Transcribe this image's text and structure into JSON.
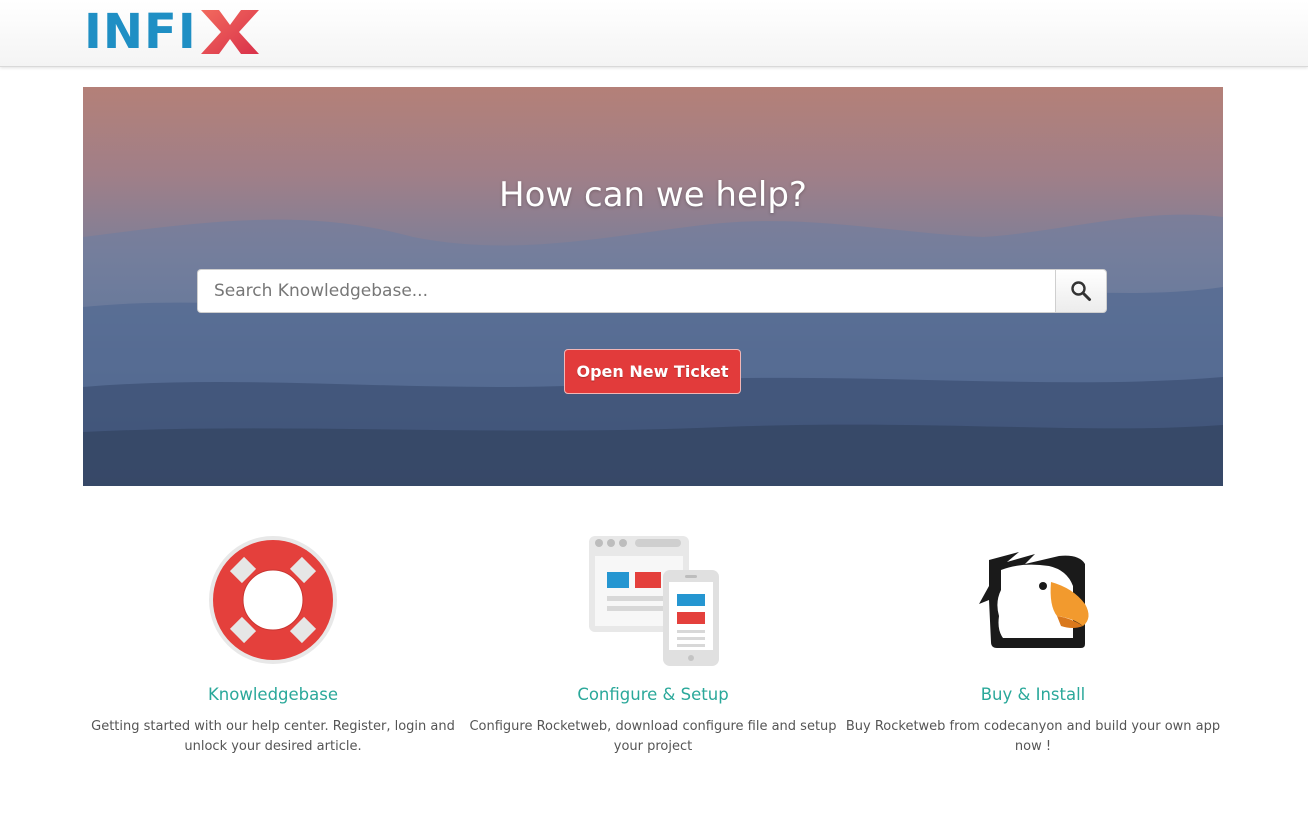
{
  "header": {
    "logo_text": "INFI",
    "logo_x": "X"
  },
  "hero": {
    "title": "How can we help?",
    "search_placeholder": "Search Knowledgebase...",
    "ticket_label": "Open New Ticket"
  },
  "features": [
    {
      "title": "Knowledgebase",
      "description": "Getting started with our help center. Register, login and unlock your desired article.",
      "icon": "lifebuoy-icon"
    },
    {
      "title": "Configure & Setup",
      "description": "Configure Rocketweb, download configure file and setup your project",
      "icon": "devices-icon"
    },
    {
      "title": "Buy & Install",
      "description": "Buy Rocketweb from codecanyon and build your own app now !",
      "icon": "eagle-icon"
    }
  ],
  "colors": {
    "brand_blue": "#1f8fc4",
    "brand_red": "#e2474e",
    "accent_teal": "#2aa89a",
    "ticket_red": "#e23b3b"
  }
}
